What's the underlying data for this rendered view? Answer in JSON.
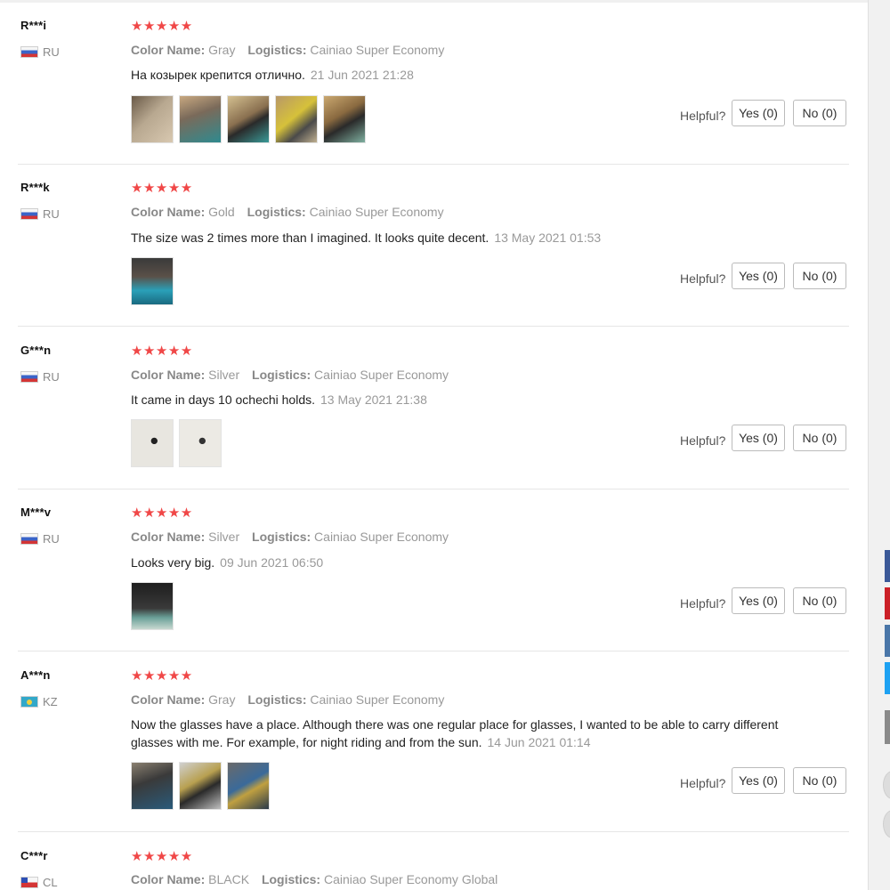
{
  "helpful_label": "Helpful?",
  "reviews": [
    {
      "user": "R***i",
      "country": "RU",
      "stars": "★★★★★",
      "color_key": "Color Name:",
      "color_value": "Gray",
      "logistics_key": "Logistics:",
      "logistics_value": "Cainiao Super Economy",
      "text": "На козырек крепится отлично.",
      "date": "21 Jun 2021 21:28",
      "photos": 5,
      "yes": "Yes (0)",
      "no": "No (0)"
    },
    {
      "user": "R***k",
      "country": "RU",
      "stars": "★★★★★",
      "color_key": "Color Name:",
      "color_value": "Gold",
      "logistics_key": "Logistics:",
      "logistics_value": "Cainiao Super Economy",
      "text": "The size was 2 times more than I imagined. It looks quite decent.",
      "date": "13 May 2021 01:53",
      "photos": 1,
      "yes": "Yes (0)",
      "no": "No (0)"
    },
    {
      "user": "G***n",
      "country": "RU",
      "stars": "★★★★★",
      "color_key": "Color Name:",
      "color_value": "Silver",
      "logistics_key": "Logistics:",
      "logistics_value": "Cainiao Super Economy",
      "text": "It came in days 10 ochechi holds.",
      "date": "13 May 2021 21:38",
      "photos": 2,
      "yes": "Yes (0)",
      "no": "No (0)"
    },
    {
      "user": "M***v",
      "country": "RU",
      "stars": "★★★★★",
      "color_key": "Color Name:",
      "color_value": "Silver",
      "logistics_key": "Logistics:",
      "logistics_value": "Cainiao Super Economy",
      "text": "Looks very big.",
      "date": "09 Jun 2021 06:50",
      "photos": 1,
      "yes": "Yes (0)",
      "no": "No (0)"
    },
    {
      "user": "A***n",
      "country": "KZ",
      "stars": "★★★★★",
      "color_key": "Color Name:",
      "color_value": "Gray",
      "logistics_key": "Logistics:",
      "logistics_value": "Cainiao Super Economy",
      "text_line1": "Now the glasses have a place. Although there was one regular place for glasses, I wanted to be able to carry different",
      "text_line2": "glasses with me. For example, for night riding and from the sun.",
      "date": "14 Jun 2021 01:14",
      "photos": 3,
      "yes": "Yes (0)",
      "no": "No (0)"
    },
    {
      "user": "C***r",
      "country": "CL",
      "stars": "★★★★★",
      "color_key": "Color Name:",
      "color_value": "BLACK",
      "logistics_key": "Logistics:",
      "logistics_value": "Cainiao Super Economy Global"
    }
  ],
  "colors": {
    "star": "#f04747",
    "share_buttons": [
      "#3b5998",
      "#cb2027",
      "#4a76a8",
      "#1da1f2",
      "#8a8a8a"
    ]
  }
}
